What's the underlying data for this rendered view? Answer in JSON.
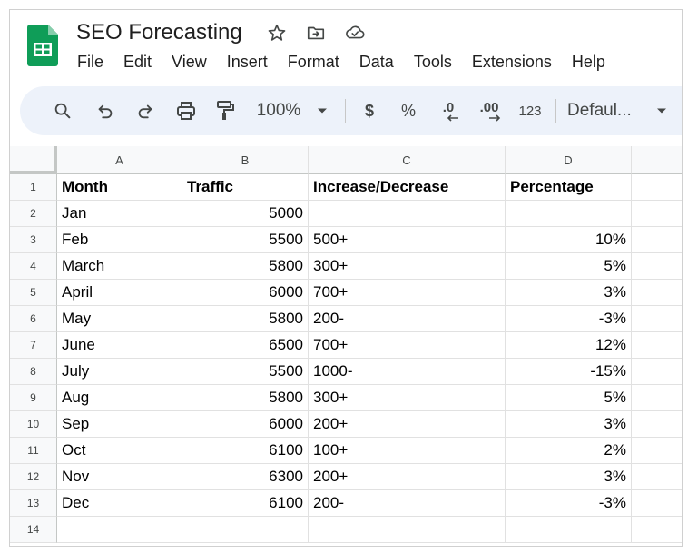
{
  "app": {
    "title": "SEO Forecasting",
    "menu": [
      "File",
      "Edit",
      "View",
      "Insert",
      "Format",
      "Data",
      "Tools",
      "Extensions",
      "Help"
    ]
  },
  "toolbar": {
    "zoom": "100%",
    "currency": "$",
    "percent": "%",
    "decrease_decimal": ".0",
    "increase_decimal": ".00",
    "number_format": "123",
    "font": "Defaul..."
  },
  "sheet": {
    "columns": [
      "A",
      "B",
      "C",
      "D"
    ],
    "row_numbers": [
      "1",
      "2",
      "3",
      "4",
      "5",
      "6",
      "7",
      "8",
      "9",
      "10",
      "11",
      "12",
      "13",
      "14"
    ],
    "rows": [
      [
        "Month",
        "Traffic",
        "Increase/Decrease",
        "Percentage"
      ],
      [
        "Jan",
        "5000",
        "",
        ""
      ],
      [
        "Feb",
        "5500",
        "500+",
        "10%"
      ],
      [
        "March",
        "5800",
        "300+",
        "5%"
      ],
      [
        "April",
        "6000",
        "700+",
        "3%"
      ],
      [
        "May",
        "5800",
        "200-",
        "-3%"
      ],
      [
        "June",
        "6500",
        "700+",
        "12%"
      ],
      [
        "July",
        "5500",
        "1000-",
        "-15%"
      ],
      [
        "Aug",
        "5800",
        "300+",
        "5%"
      ],
      [
        "Sep",
        "6000",
        "200+",
        "3%"
      ],
      [
        "Oct",
        "6100",
        "100+",
        "2%"
      ],
      [
        "Nov",
        "6300",
        "200+",
        "3%"
      ],
      [
        "Dec",
        "6100",
        "200-",
        "-3%"
      ],
      [
        "",
        "",
        "",
        ""
      ]
    ]
  }
}
